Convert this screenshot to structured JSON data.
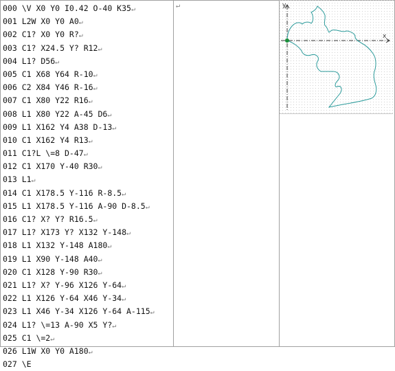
{
  "program_lines": [
    "000 \\V X0 Y0 I0.42 O-40 K35",
    "001 L2W X0 Y0 A0",
    "002 C1? X0 Y0 R?",
    "003 C1? X24.5 Y? R12",
    "004 L1? D56",
    "005 C1 X68 Y64 R-10",
    "006 C2 X84 Y46 R-16",
    "007 C1 X80 Y22 R16",
    "008 L1 X80 Y22 A-45 D6",
    "009 L1 X162 Y4 A38 D-13",
    "010 C1 X162 Y4 R13",
    "011 C1?L \\=8 D-47",
    "012 C1 X170 Y-40 R30",
    "013 L1",
    "014 C1 X178.5 Y-116 R-8.5",
    "015 L1 X178.5 Y-116 A-90 D-8.5",
    "016 C1? X? Y? R16.5",
    "017 L1? X173 Y? X132 Y-148",
    "018 L1 X132 Y-148 A180",
    "019 L1 X90 Y-148 A40",
    "020 C1 X128 Y-90 R30",
    "021 L1? X? Y-96 X126 Y-64",
    "022 L1 X126 Y-64 X46 Y-34",
    "023 L1 X46 Y-34 X126 Y-64 A-115",
    "024 L1? \\=13 A-90 X5 Y?",
    "025 C1 \\=2",
    "026 L1W X0 Y0 A180",
    "027 \\E"
  ],
  "return_mark": "↵",
  "axis_labels": {
    "x": "x",
    "y": "y"
  },
  "colors": {
    "contour": "#2a9a9a",
    "axes": "#333333",
    "origin": "#1a8f3a"
  }
}
